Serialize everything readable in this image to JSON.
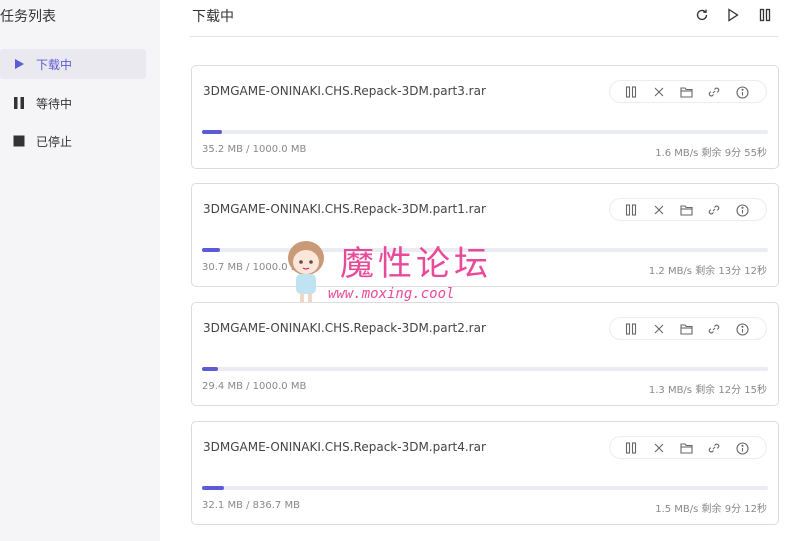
{
  "sidebar": {
    "title": "任务列表",
    "items": [
      {
        "label": "下载中",
        "icon": "play-icon"
      },
      {
        "label": "等待中",
        "icon": "pause-icon"
      },
      {
        "label": "已停止",
        "icon": "stop-icon"
      }
    ]
  },
  "main": {
    "title": "下载中",
    "toolbar": [
      "refresh-icon",
      "play-icon",
      "pause-icon"
    ]
  },
  "tasks": [
    {
      "name": "3DMGAME-ONINAKI.CHS.Repack-3DM.part3.rar",
      "size": "35.2 MB / 1000.0 MB",
      "speed": "1.6 MB/s 剩余 9分 55秒",
      "progress": 0.035
    },
    {
      "name": "3DMGAME-ONINAKI.CHS.Repack-3DM.part1.rar",
      "size": "30.7 MB / 1000.0 MB",
      "speed": "1.2 MB/s 剩余 13分 12秒",
      "progress": 0.031
    },
    {
      "name": "3DMGAME-ONINAKI.CHS.Repack-3DM.part2.rar",
      "size": "29.4 MB / 1000.0 MB",
      "speed": "1.3 MB/s 剩余 12分 15秒",
      "progress": 0.029
    },
    {
      "name": "3DMGAME-ONINAKI.CHS.Repack-3DM.part4.rar",
      "size": "32.1 MB / 836.7 MB",
      "speed": "1.5 MB/s 剩余 9分 12秒",
      "progress": 0.038
    }
  ],
  "task_actions": [
    "pause-icon",
    "delete-icon",
    "folder-icon",
    "link-icon",
    "info-icon"
  ],
  "watermark": {
    "text": "魔性论坛",
    "url": "www.moxing.cool"
  },
  "colors": {
    "accent": "#5b5bd6",
    "sidebar_bg": "#f5f5f7",
    "watermark": "#e84a9a"
  }
}
